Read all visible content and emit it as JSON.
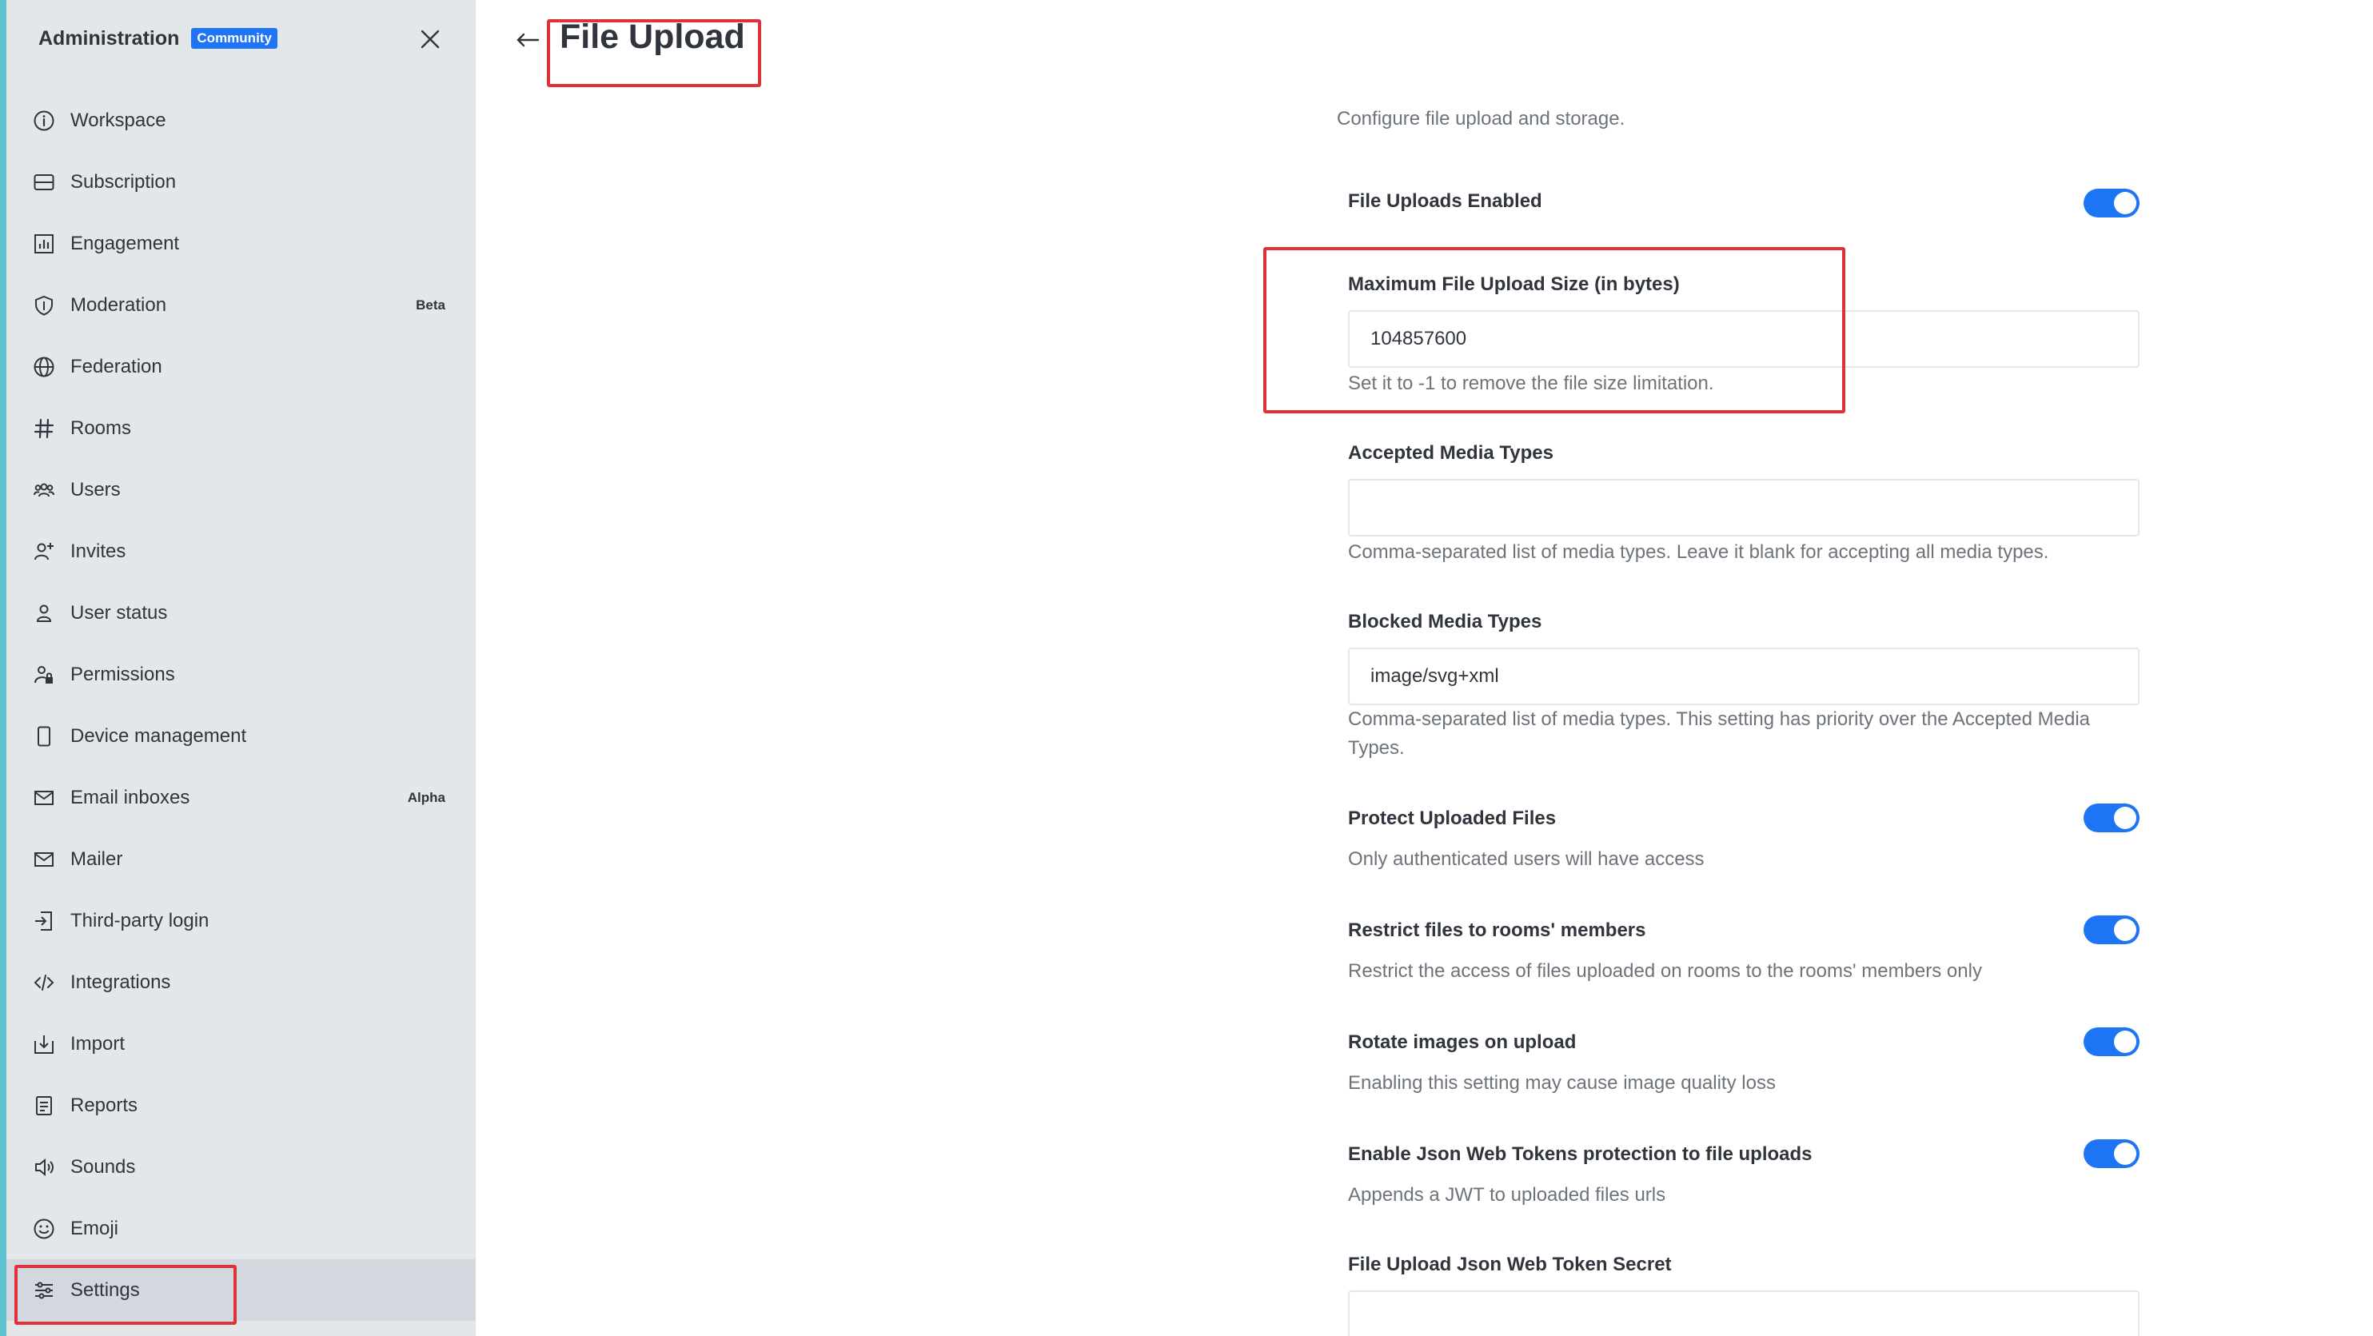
{
  "sidebar": {
    "title": "Administration",
    "badge": "Community",
    "items": [
      {
        "label": "Workspace",
        "icon": "info-circle-icon"
      },
      {
        "label": "Subscription",
        "icon": "card-icon"
      },
      {
        "label": "Engagement",
        "icon": "bar-chart-icon"
      },
      {
        "label": "Moderation",
        "icon": "shield-icon",
        "tag": "Beta"
      },
      {
        "label": "Federation",
        "icon": "globe-icon"
      },
      {
        "label": "Rooms",
        "icon": "hashtag-icon"
      },
      {
        "label": "Users",
        "icon": "team-icon"
      },
      {
        "label": "Invites",
        "icon": "user-plus-icon"
      },
      {
        "label": "User status",
        "icon": "user-icon"
      },
      {
        "label": "Permissions",
        "icon": "user-lock-icon"
      },
      {
        "label": "Device management",
        "icon": "mobile-icon"
      },
      {
        "label": "Email inboxes",
        "icon": "mail-icon",
        "tag": "Alpha"
      },
      {
        "label": "Mailer",
        "icon": "mail-icon"
      },
      {
        "label": "Third-party login",
        "icon": "login-icon"
      },
      {
        "label": "Integrations",
        "icon": "code-icon"
      },
      {
        "label": "Import",
        "icon": "import-icon"
      },
      {
        "label": "Reports",
        "icon": "document-icon"
      },
      {
        "label": "Sounds",
        "icon": "speaker-icon"
      },
      {
        "label": "Emoji",
        "icon": "emoji-icon"
      },
      {
        "label": "Settings",
        "icon": "sliders-icon",
        "active": true
      }
    ]
  },
  "header": {
    "title": "File Upload"
  },
  "main": {
    "description": "Configure file upload and storage.",
    "settings": {
      "uploads_enabled": {
        "label": "File Uploads Enabled",
        "enabled": true
      },
      "max_size": {
        "label": "Maximum File Upload Size (in bytes)",
        "value": "104857600",
        "hint": "Set it to -1 to remove the file size limitation."
      },
      "accepted_types": {
        "label": "Accepted Media Types",
        "value": "",
        "hint": "Comma-separated list of media types. Leave it blank for accepting all media types."
      },
      "blocked_types": {
        "label": "Blocked Media Types",
        "value": "image/svg+xml",
        "hint": "Comma-separated list of media types. This setting has priority over the Accepted Media Types."
      },
      "protect_files": {
        "label": "Protect Uploaded Files",
        "hint": "Only authenticated users will have access",
        "enabled": true
      },
      "restrict_rooms": {
        "label": "Restrict files to rooms' members",
        "hint": "Restrict the access of files uploaded on rooms to the rooms' members only",
        "enabled": true
      },
      "rotate_images": {
        "label": "Rotate images on upload",
        "hint": "Enabling this setting may cause image quality loss",
        "enabled": true
      },
      "jwt_protection": {
        "label": "Enable Json Web Tokens protection to file uploads",
        "hint": "Appends a JWT to uploaded files urls",
        "enabled": true
      },
      "jwt_secret": {
        "label": "File Upload Json Web Token Secret",
        "value": ""
      }
    }
  },
  "colors": {
    "accent": "#1d74f5",
    "highlight": "#e0303a",
    "sidebar_bg": "#e4e7ea"
  }
}
